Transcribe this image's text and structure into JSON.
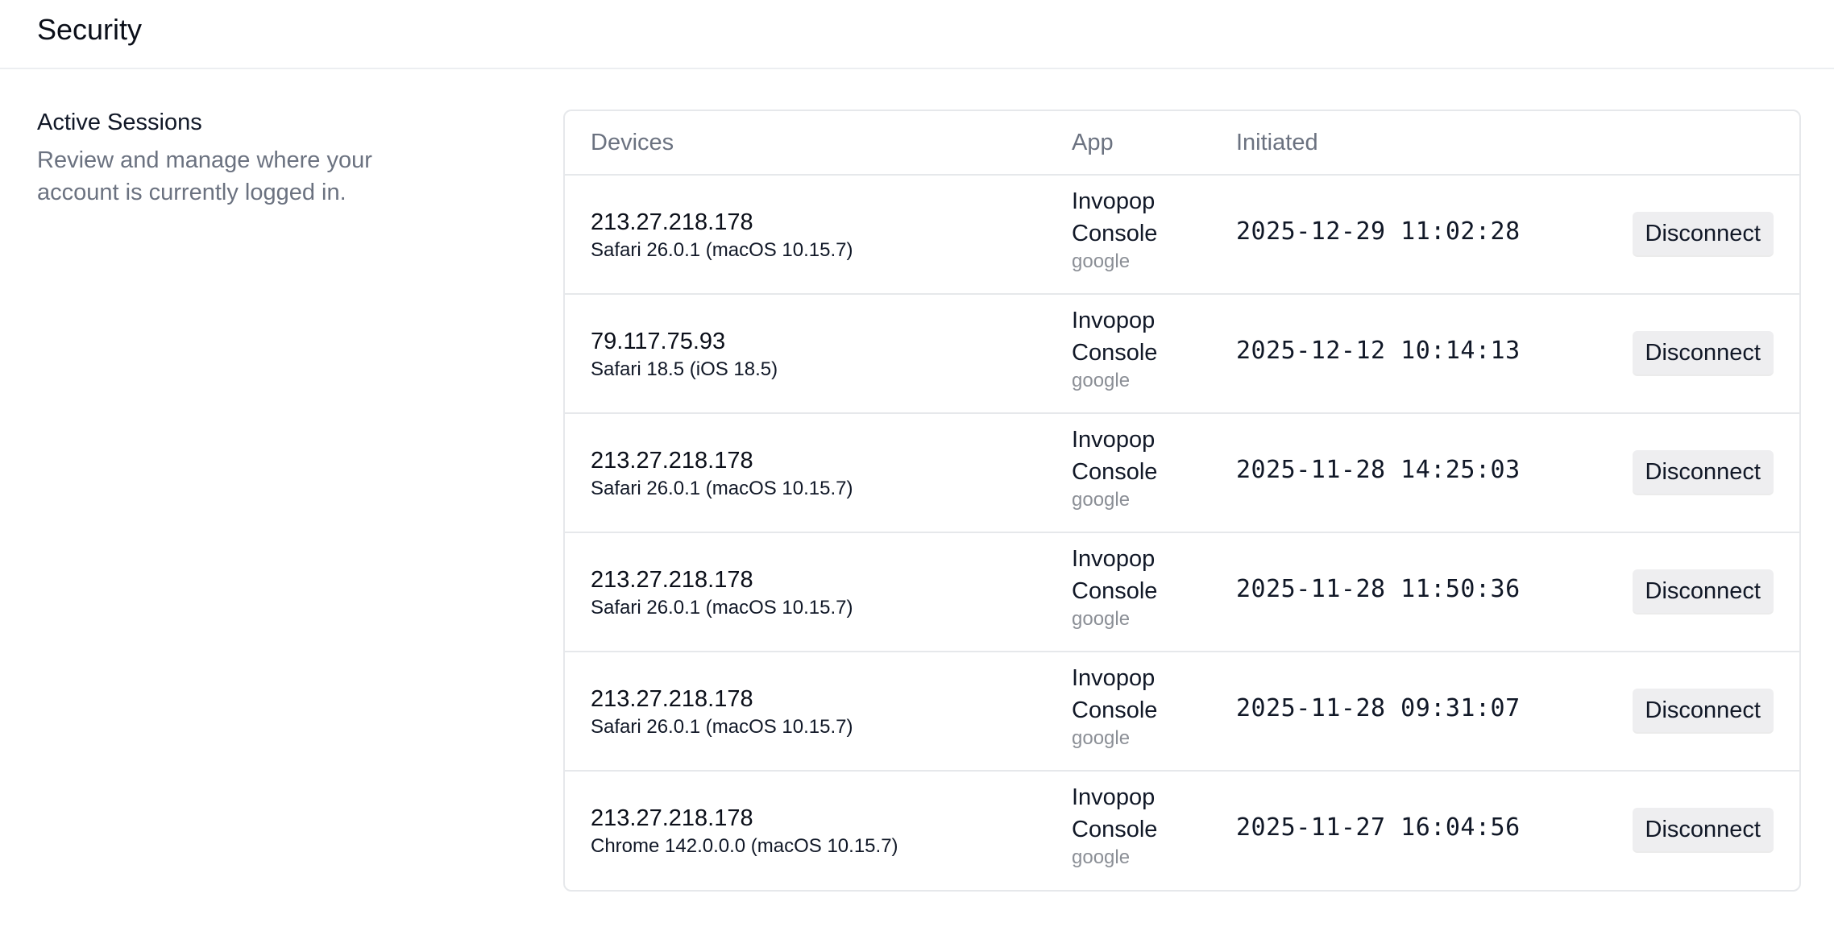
{
  "header": {
    "title": "Security"
  },
  "section": {
    "heading": "Active Sessions",
    "description": "Review and manage where your account is currently logged in."
  },
  "table": {
    "columns": {
      "devices": "Devices",
      "app": "App",
      "initiated": "Initiated"
    },
    "rows": [
      {
        "ip": "213.27.218.178",
        "browser": "Safari 26.0.1 (macOS 10.15.7)",
        "app": "Invopop Console",
        "provider": "google",
        "initiated": "2025-12-29 11:02:28",
        "action": "Disconnect"
      },
      {
        "ip": "79.117.75.93",
        "browser": "Safari 18.5 (iOS 18.5)",
        "app": "Invopop Console",
        "provider": "google",
        "initiated": "2025-12-12 10:14:13",
        "action": "Disconnect"
      },
      {
        "ip": "213.27.218.178",
        "browser": "Safari 26.0.1 (macOS 10.15.7)",
        "app": "Invopop Console",
        "provider": "google",
        "initiated": "2025-11-28 14:25:03",
        "action": "Disconnect"
      },
      {
        "ip": "213.27.218.178",
        "browser": "Safari 26.0.1 (macOS 10.15.7)",
        "app": "Invopop Console",
        "provider": "google",
        "initiated": "2025-11-28 11:50:36",
        "action": "Disconnect"
      },
      {
        "ip": "213.27.218.178",
        "browser": "Safari 26.0.1 (macOS 10.15.7)",
        "app": "Invopop Console",
        "provider": "google",
        "initiated": "2025-11-28 09:31:07",
        "action": "Disconnect"
      },
      {
        "ip": "213.27.218.178",
        "browser": "Chrome 142.0.0.0 (macOS 10.15.7)",
        "app": "Invopop Console",
        "provider": "google",
        "initiated": "2025-11-27 16:04:56",
        "action": "Disconnect"
      }
    ]
  }
}
